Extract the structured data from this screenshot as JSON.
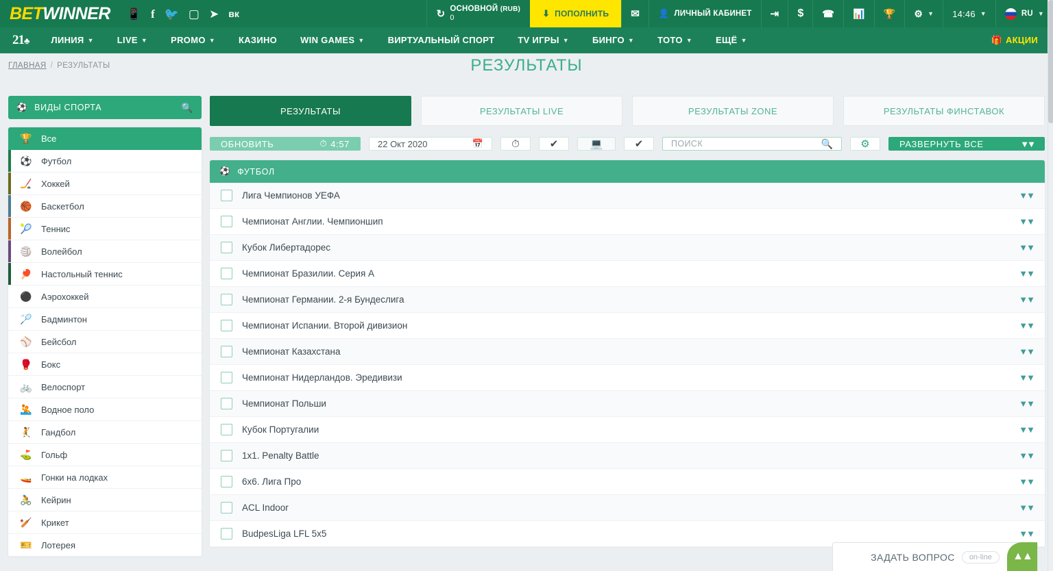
{
  "header": {
    "logo_bet": "BET",
    "logo_win": "WINNER",
    "social_icons": [
      "mobile-icon",
      "facebook-icon",
      "twitter-icon",
      "instagram-icon",
      "telegram-icon",
      "vk-icon"
    ],
    "balance_label": "ОСНОВНОЙ",
    "balance_currency": "(RUB)",
    "balance_amount": "0",
    "deposit_label": "ПОПОЛНИТЬ",
    "account_label": "ЛИЧНЫЙ КАБИНЕТ",
    "clock": "14:46",
    "language": "RU"
  },
  "nav": {
    "brand_21": "21",
    "items": [
      {
        "label": "ЛИНИЯ",
        "caret": true
      },
      {
        "label": "LIVE",
        "caret": true
      },
      {
        "label": "PROMO",
        "caret": true
      },
      {
        "label": "КАЗИНО",
        "caret": false
      },
      {
        "label": "WIN GAMES",
        "caret": true
      },
      {
        "label": "ВИРТУАЛЬНЫЙ СПОРТ",
        "caret": false
      },
      {
        "label": "TV ИГРЫ",
        "caret": true
      },
      {
        "label": "БИНГО",
        "caret": true
      },
      {
        "label": "ТОТО",
        "caret": true
      },
      {
        "label": "ЕЩЁ",
        "caret": true
      }
    ],
    "promo_label": "АКЦИИ"
  },
  "breadcrumb": {
    "home": "ГЛАВНАЯ",
    "separator": "/",
    "current": "РЕЗУЛЬТАТЫ"
  },
  "page_title": "РЕЗУЛЬТАТЫ",
  "sidebar": {
    "header_title": "ВИДЫ СПОРТА",
    "items": [
      {
        "label": "Все",
        "icon": "trophy-icon",
        "active": true,
        "bar": "transparent"
      },
      {
        "label": "Футбол",
        "icon": "soccer-icon",
        "active": false,
        "bar": "#1d7a4c"
      },
      {
        "label": "Хоккей",
        "icon": "hockey-puck-icon",
        "active": false,
        "bar": "#6b6b1f"
      },
      {
        "label": "Баскетбол",
        "icon": "basketball-icon",
        "active": false,
        "bar": "#4a7d92"
      },
      {
        "label": "Теннис",
        "icon": "tennis-ball-icon",
        "active": false,
        "bar": "#b9642a"
      },
      {
        "label": "Волейбол",
        "icon": "volleyball-icon",
        "active": false,
        "bar": "#6b4a7d"
      },
      {
        "label": "Настольный теннис",
        "icon": "table-tennis-icon",
        "active": false,
        "bar": "#1d5c3a"
      },
      {
        "label": "Аэрохоккей",
        "icon": "air-hockey-icon",
        "active": false,
        "bar": "transparent"
      },
      {
        "label": "Бадминтон",
        "icon": "badminton-icon",
        "active": false,
        "bar": "transparent"
      },
      {
        "label": "Бейсбол",
        "icon": "baseball-icon",
        "active": false,
        "bar": "transparent"
      },
      {
        "label": "Бокс",
        "icon": "boxing-glove-icon",
        "active": false,
        "bar": "transparent"
      },
      {
        "label": "Велоспорт",
        "icon": "bicycle-icon",
        "active": false,
        "bar": "transparent"
      },
      {
        "label": "Водное поло",
        "icon": "water-polo-icon",
        "active": false,
        "bar": "transparent"
      },
      {
        "label": "Гандбол",
        "icon": "handball-icon",
        "active": false,
        "bar": "transparent"
      },
      {
        "label": "Гольф",
        "icon": "golf-flag-icon",
        "active": false,
        "bar": "transparent"
      },
      {
        "label": "Гонки на лодках",
        "icon": "boat-racing-icon",
        "active": false,
        "bar": "transparent"
      },
      {
        "label": "Кейрин",
        "icon": "keirin-icon",
        "active": false,
        "bar": "transparent"
      },
      {
        "label": "Крикет",
        "icon": "cricket-bat-icon",
        "active": false,
        "bar": "transparent"
      },
      {
        "label": "Лотерея",
        "icon": "lottery-ticket-icon",
        "active": false,
        "bar": "transparent"
      }
    ]
  },
  "main": {
    "tabs": [
      {
        "label": "РЕЗУЛЬТАТЫ",
        "active": true
      },
      {
        "label": "РЕЗУЛЬТАТЫ LIVE",
        "active": false
      },
      {
        "label": "РЕЗУЛЬТАТЫ ZONE",
        "active": false
      },
      {
        "label": "РЕЗУЛЬТАТЫ ФИНСТАВОК",
        "active": false
      }
    ],
    "toolbar": {
      "refresh_label": "ОБНОВИТЬ",
      "timer": "4:57",
      "date_value": "22 Окт 2020",
      "search_placeholder": "ПОИСК",
      "search_value": "",
      "expand_label": "РАЗВЕРНУТЬ ВСЕ"
    },
    "sport_section": {
      "title": "ФУТБОЛ",
      "leagues": [
        {
          "name": "Лига Чемпионов УЕФА"
        },
        {
          "name": "Чемпионат Англии. Чемпионшип"
        },
        {
          "name": "Кубок Либертадорес"
        },
        {
          "name": "Чемпионат Бразилии. Серия А"
        },
        {
          "name": "Чемпионат Германии. 2-я Бундеслига"
        },
        {
          "name": "Чемпионат Испании. Второй дивизион"
        },
        {
          "name": "Чемпионат Казахстана"
        },
        {
          "name": "Чемпионат Нидерландов. Эредивизи"
        },
        {
          "name": "Чемпионат Польши"
        },
        {
          "name": "Кубок Португалии"
        },
        {
          "name": "1x1. Penalty Battle"
        },
        {
          "name": "6x6. Лига Про"
        },
        {
          "name": "ACL Indoor"
        },
        {
          "name": "BudpesLiga LFL 5x5"
        }
      ]
    }
  },
  "chat": {
    "label": "ЗАДАТЬ ВОПРОС",
    "status": "on-line"
  },
  "colors": {
    "brand_green": "#17794f",
    "nav_green": "#1c8158",
    "accent_green": "#2ca87a",
    "yellow": "#ffe600",
    "page_bg": "#eceff1"
  }
}
